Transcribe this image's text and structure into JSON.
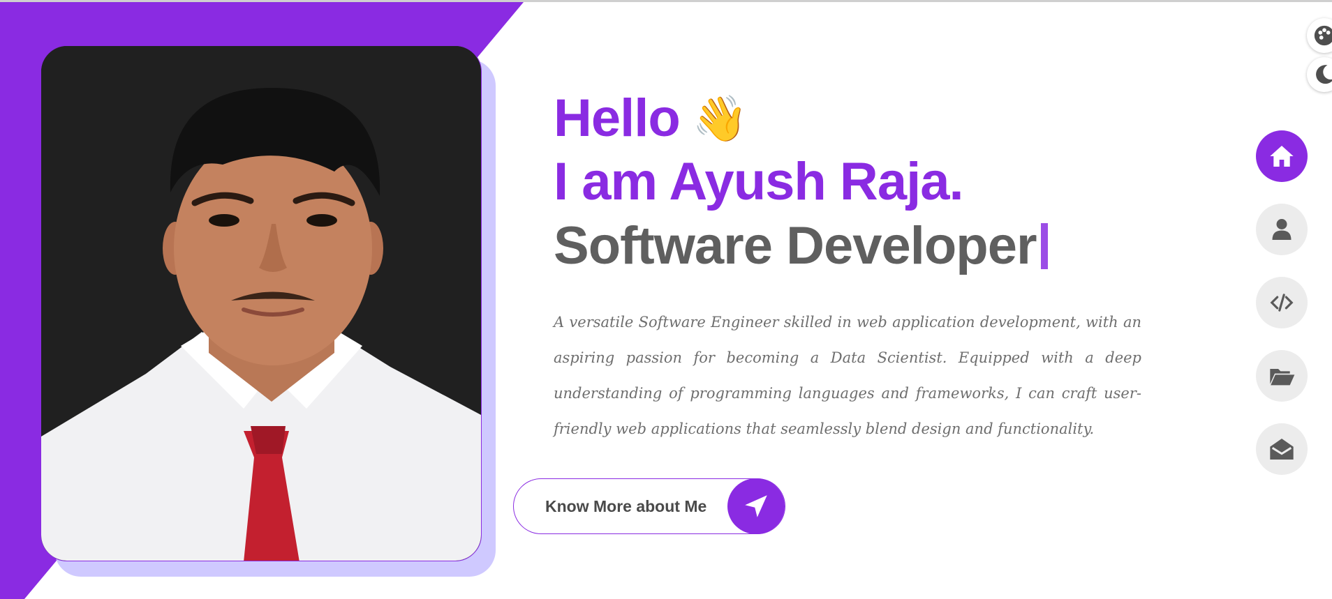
{
  "hero": {
    "greeting": "Hello",
    "wave_emoji": "👋",
    "name_line": "I am Ayush Raja.",
    "role": "Software Developer",
    "bio": "A versatile Software Engineer skilled in web application development, with an aspiring passion for becoming a Data Scientist. Equipped with a deep understanding of programming languages and frameworks, I can craft user-friendly web applications that seamlessly blend design and functionality.",
    "cta_label": "Know More about Me",
    "cta_icon": "paper-plane-icon"
  },
  "photo": {
    "alt": "Ayush Raja portrait"
  },
  "side_nav": {
    "items": [
      {
        "icon": "home-icon",
        "active": true
      },
      {
        "icon": "user-icon",
        "active": false
      },
      {
        "icon": "code-icon",
        "active": false
      },
      {
        "icon": "folder-open-icon",
        "active": false
      },
      {
        "icon": "envelope-open-icon",
        "active": false
      }
    ]
  },
  "tools": {
    "palette_icon": "palette-icon",
    "theme_icon": "moon-icon"
  },
  "colors": {
    "accent": "#8a2be2",
    "accent_light": "#cfc9ff",
    "heading_gray": "#5f5f5f",
    "body_gray": "#6e6e6e",
    "nav_bg": "#ececec"
  }
}
